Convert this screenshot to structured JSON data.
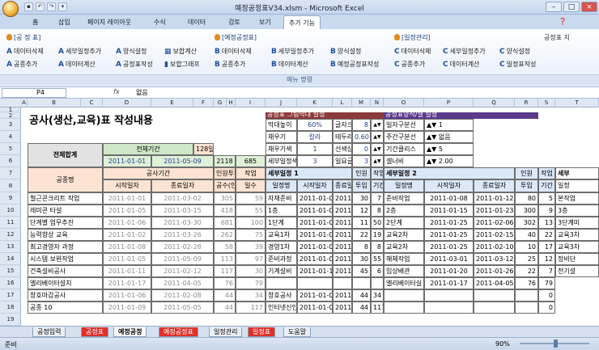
{
  "window": {
    "title": "예정공정표V34.xlsm - Microsoft Excel"
  },
  "tabs": [
    "홈",
    "삽입",
    "페이지 레이아웃",
    "수식",
    "데이터",
    "검토",
    "보기",
    "추가 기능"
  ],
  "active_tab": "추가 기능",
  "ribbon": {
    "groups": [
      "[공 정 표]",
      "[예정공정표]",
      "[일정관리]"
    ],
    "right_label": "공정표 지",
    "items": [
      [
        "데이터삭제",
        "세부일정추가",
        "양식설정",
        "보합계산"
      ],
      [
        "공종추가",
        "데이터계산",
        "공정표작성",
        "보합그래프"
      ],
      [
        "데이터삭제",
        "세부일정추가",
        "양식설정"
      ],
      [
        "공종추가",
        "데이터계산",
        "예정공정표작성"
      ],
      [
        "데이터삭제",
        "세부일정추가",
        "양식설정"
      ],
      [
        "공종추가",
        "데이터계산",
        "일정표작성"
      ]
    ],
    "footer": "메뉴 명령"
  },
  "formula": {
    "cell": "P4",
    "value": "없음"
  },
  "columns": [
    "A",
    "B",
    "C",
    "D",
    "E",
    "F",
    "G",
    "H",
    "I",
    "J",
    "K",
    "L",
    "M",
    "N",
    "O",
    "P",
    "Q",
    "R",
    "S",
    "T"
  ],
  "rows": [
    "1",
    "2",
    "3",
    "4",
    "5",
    "6",
    "7",
    "8",
    "9",
    "10",
    "11",
    "12",
    "13",
    "14",
    "15",
    "16",
    "17",
    "18",
    "19",
    "20"
  ],
  "sheet": {
    "title": "공사(생산,교육)표 작성내용",
    "total_label": "전체합계",
    "period_label": "전체기간",
    "period_days": "128일",
    "start": "2011-01-01",
    "end": "2011-05-09",
    "sum_a": "2118",
    "sum_b": "685",
    "h_name": "공종명",
    "h_period": "공사기간",
    "h_start": "시작일자",
    "h_end": "종료일자",
    "h_input": "인원투입",
    "h_work": "작업",
    "h_count": "공수(인)",
    "h_days": "일수",
    "rows": [
      [
        "철근콘크리트 작업",
        "2011-01-01",
        "2011-03-02",
        "305",
        "59"
      ],
      [
        "레미콘 타설",
        "2011-01-05",
        "2011-03-15",
        "418",
        "55"
      ],
      [
        "단계별 업무추진",
        "2011-01-06",
        "2011-03-30",
        "681",
        "100"
      ],
      [
        "능력향상 교육",
        "2011-01-02",
        "2011-03-26",
        "262",
        "75"
      ],
      [
        "최고경영자 과정",
        "2011-01-08",
        "2011-02-28",
        "58",
        "39"
      ],
      [
        "시스템 보완작업",
        "2011-01-05",
        "2011-05-09",
        "113",
        "97"
      ],
      [
        "건축설비공사",
        "2011-01-11",
        "2011-02-12",
        "117",
        "30"
      ],
      [
        "엘리베이터설치",
        "2011-01-17",
        "2011-04-05",
        "76",
        "79"
      ],
      [
        "창호마감공사",
        "2011-01-06",
        "2011-02-08",
        "44",
        "34"
      ],
      [
        "공종 10",
        "2011-01-09",
        "2011-05-05",
        "44",
        "117"
      ]
    ],
    "settings1": {
      "title": "공정표 그림막대 설정",
      "labels": [
        "막대높이",
        "채우기",
        "채우기색",
        "세부일정색",
        "글자크기",
        "테두리선",
        "선색상",
        "일요글자색"
      ],
      "values": [
        "60%",
        "칼라",
        "1",
        "3",
        "8",
        "0.60",
        "0",
        "3"
      ]
    },
    "settings2": {
      "title": "공정표양식/셀 설정",
      "labels": [
        "일자구분선",
        "주간구분선",
        "기간클리스",
        "셀너비"
      ],
      "values": [
        "1",
        "없음",
        "5",
        "2.00"
      ]
    },
    "detail1": {
      "title": "세부일정 1",
      "h_name": "일정명",
      "h_start": "시작일자",
      "h_end": "종료일자",
      "h_input": "인원",
      "h_work": "작업",
      "h_input2": "투입",
      "h_days": "기간",
      "rows": [
        [
          "자재준비",
          "2011-01-01",
          "2011-01-07",
          "30",
          "7"
        ],
        [
          "1층",
          "2011-01-05",
          "2011-01-12",
          "12",
          "8"
        ],
        [
          "1단계",
          "2011-01-06",
          "2011-02-24",
          "11",
          "50"
        ],
        [
          "교육1차",
          "2011-01-02",
          "2011-01-20",
          "22",
          "19"
        ],
        [
          "경영1차",
          "2011-01-08",
          "2011-01-15",
          "8",
          "8"
        ],
        [
          "준비과정",
          "2011-01-05",
          "2011-02-28",
          "30",
          "55"
        ],
        [
          "기계설비",
          "2011-01-11",
          "2011-01-16",
          "45",
          "6"
        ],
        [
          "",
          "",
          "",
          "",
          ""
        ],
        [
          "창호공사",
          "2011-01-06",
          "2011-02-08",
          "44",
          "34"
        ],
        [
          "인터넷신인업",
          "2011-01-09",
          "2011-05-05",
          "44",
          "117"
        ]
      ]
    },
    "detail2": {
      "title": "세부일정 2",
      "h_name": "일정명",
      "h_start": "시작일자",
      "h_end": "종료일자",
      "h_input": "인원",
      "h_work": "작업",
      "h_input2": "투입",
      "h_days": "기간",
      "rows": [
        [
          "준비작업",
          "2011-01-08",
          "2011-01-12",
          "80",
          "5"
        ],
        [
          "2층",
          "2011-01-15",
          "2011-01-23",
          "300",
          "9"
        ],
        [
          "2단계",
          "2011-01-25",
          "2011-02-06",
          "302",
          "13"
        ],
        [
          "교육2차",
          "2011-01-25",
          "2011-02-15",
          "40",
          "22"
        ],
        [
          "교육2차",
          "2011-01-25",
          "2011-02-10",
          "10",
          "17"
        ],
        [
          "해체작업",
          "2011-03-01",
          "2011-03-12",
          "25",
          "12"
        ],
        [
          "입상배관",
          "2011-01-20",
          "2011-01-26",
          "22",
          "7"
        ],
        [
          "엘리베이터실",
          "2011-01-17",
          "2011-04-05",
          "76",
          "79"
        ],
        [
          "",
          "",
          "",
          "",
          "0"
        ],
        [
          "",
          "",
          "",
          "",
          "0"
        ]
      ],
      "next": [
        "세부",
        "일정",
        "본작업",
        "3층",
        "3단계미",
        "교육3차",
        "교육3차",
        "정비단",
        "전기설"
      ]
    }
  },
  "sheet_tabs": [
    "공정입력",
    "공정표",
    "예정공정",
    "예정공정표",
    "일정관리",
    "일정표",
    "도움말"
  ],
  "active_sheet": "예정공정",
  "status": {
    "left": "준비",
    "zoom": "90%"
  }
}
